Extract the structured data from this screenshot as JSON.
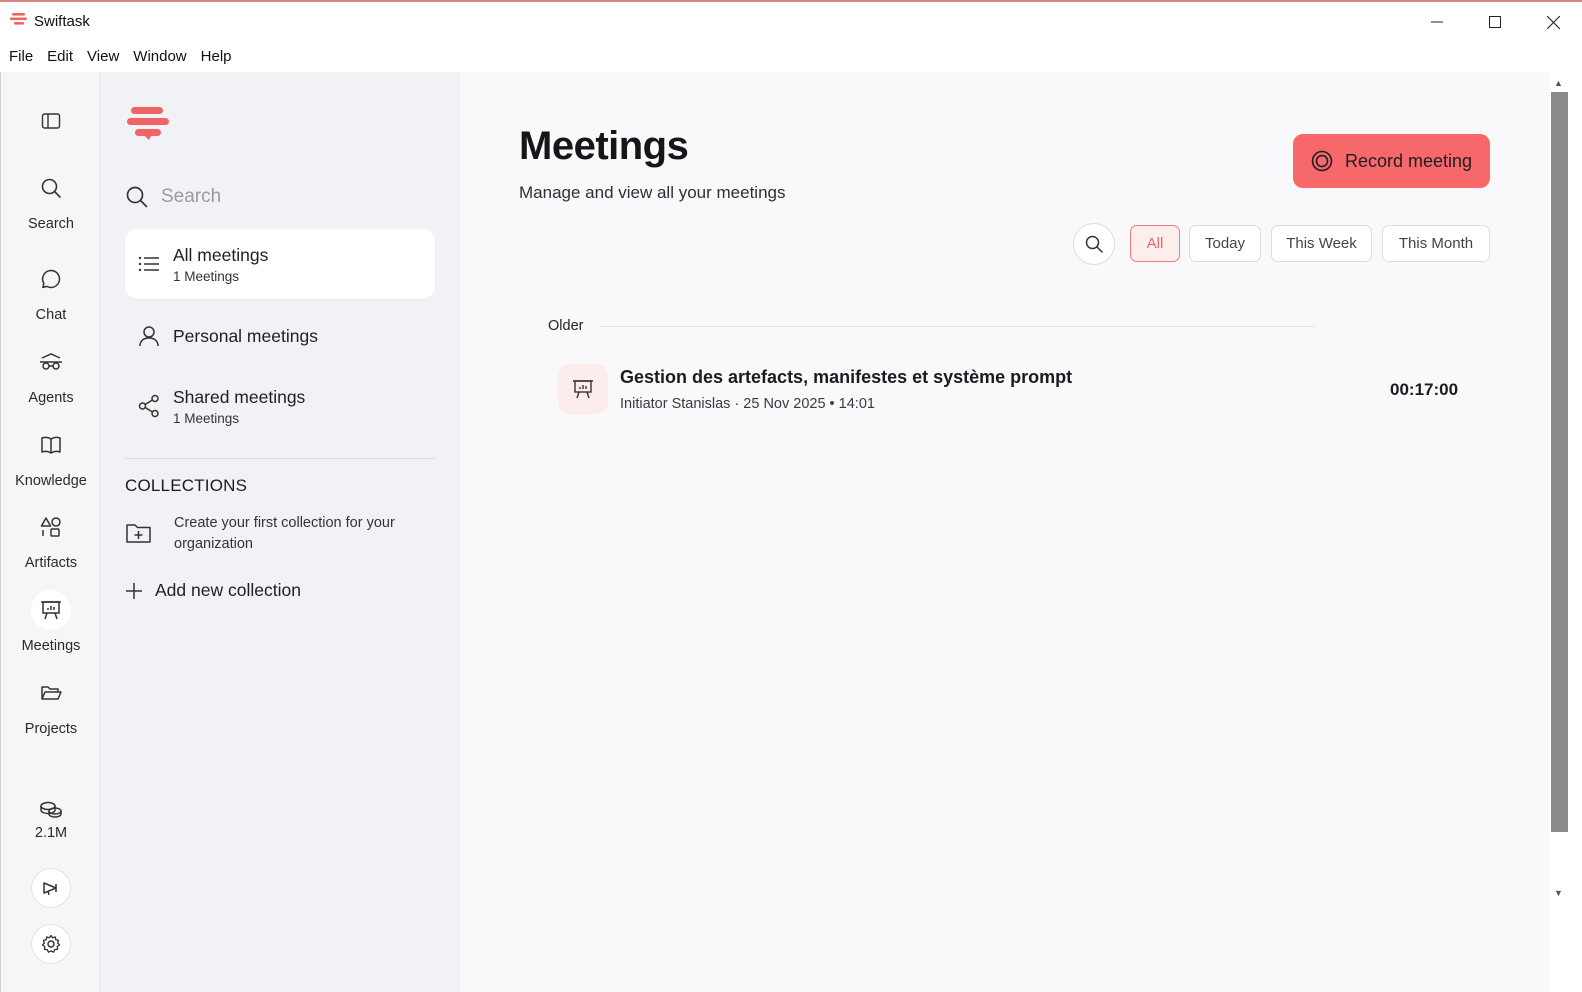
{
  "window": {
    "title": "Swiftask"
  },
  "menu": [
    "File",
    "Edit",
    "View",
    "Window",
    "Help"
  ],
  "rail": {
    "items": [
      {
        "label": "Search",
        "icon": "search-icon"
      },
      {
        "label": "Chat",
        "icon": "chat-icon"
      },
      {
        "label": "Agents",
        "icon": "agents-icon"
      },
      {
        "label": "Knowledge",
        "icon": "book-icon"
      },
      {
        "label": "Artifacts",
        "icon": "shapes-icon"
      },
      {
        "label": "Meetings",
        "icon": "presentation-icon",
        "active": true
      },
      {
        "label": "Projects",
        "icon": "folder-icon"
      }
    ],
    "credits": "2.1M"
  },
  "sidebar": {
    "search_placeholder": "Search",
    "nav": [
      {
        "title": "All meetings",
        "sub": "1 Meetings"
      },
      {
        "title": "Personal meetings"
      },
      {
        "title": "Shared meetings",
        "sub": "1 Meetings"
      }
    ],
    "collections_title": "COLLECTIONS",
    "collections_empty": "Create your first collection for your organization",
    "add_collection": "Add new collection"
  },
  "main": {
    "title": "Meetings",
    "subtitle": "Manage and view all your meetings",
    "record_button": "Record meeting",
    "filters": [
      "All",
      "Today",
      "This Week",
      "This Month"
    ],
    "active_filter": "All",
    "section": "Older",
    "meetings": [
      {
        "title": "Gestion des artefacts, manifestes et système prompt",
        "meta": "Initiator Stanislas · 25 Nov 2025 • 14:01",
        "duration": "00:17:00"
      }
    ]
  },
  "colors": {
    "accent": "#f7686b",
    "accent_light": "#fdeeee",
    "sidebar_bg": "#f1f2f5",
    "rail_bg": "#f6f6f8"
  }
}
